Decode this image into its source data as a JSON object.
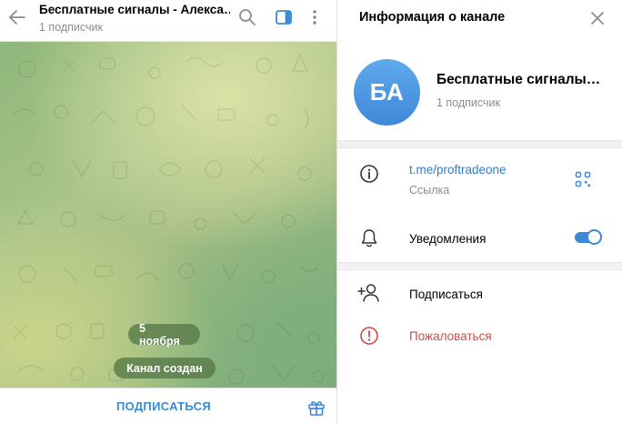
{
  "chat": {
    "title": "Бесплатные сигналы - Алекса…",
    "subtitle": "1 подписчик",
    "date_badge": "5 ноября",
    "service_message": "Канал создан",
    "subscribe_label": "ПОДПИСАТЬСЯ"
  },
  "info_panel": {
    "title": "Информация о канале",
    "avatar_initials": "БА",
    "channel_name": "Бесплатные сигналы…",
    "subscribers": "1 подписчик",
    "link": "t.me/proftradeone",
    "link_caption": "Ссылка",
    "notifications_label": "Уведомления",
    "notifications_enabled": true,
    "subscribe_action": "Подписаться",
    "report_action": "Пожаловаться"
  },
  "icons": {
    "back": "arrow-left-icon",
    "search": "search-icon",
    "side_panel": "sidebar-toggle-icon",
    "more": "more-vertical-icon",
    "gift": "gift-icon",
    "close": "close-icon",
    "info": "info-icon",
    "qr": "qr-code-icon",
    "bell": "bell-icon",
    "add_user": "add-user-icon",
    "report": "report-icon"
  },
  "colors": {
    "accent": "#3e88d8",
    "link": "#2f7dc4",
    "danger": "#d14b4b",
    "muted": "#8c8c8c",
    "chat_background": "#a9c48a"
  }
}
